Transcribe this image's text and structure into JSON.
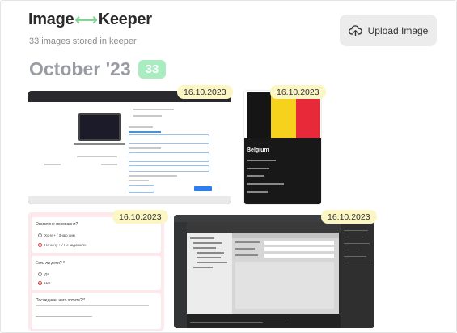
{
  "header": {
    "logo_part1": "Image",
    "logo_arrow": "⟷",
    "logo_part2": "Keeper",
    "subtitle": "33 images stored in keeper",
    "upload_label": "Upload Image",
    "upload_icon": "cloud-upload-icon"
  },
  "group": {
    "title": "October '23",
    "count": "33"
  },
  "cards": [
    {
      "date": "16.10.2023",
      "kind": "screenshot-laptop-store"
    },
    {
      "date": "16.10.2023",
      "kind": "screenshot-flag-belgium",
      "country": "Belgium"
    },
    {
      "date": "16.10.2023",
      "kind": "screenshot-form",
      "questions": [
        {
          "text": "Оживлене поховання?",
          "options": [
            "Хочу + / Знаю хим",
            "Не хочу + / Не задоволен"
          ]
        },
        {
          "text": "Есть ли дети? *",
          "options": [
            "Да",
            "Нет"
          ]
        },
        {
          "text": "Последнее, чего хотите? *",
          "options": []
        }
      ]
    },
    {
      "date": "16.10.2023",
      "kind": "screenshot-ide"
    }
  ],
  "colors": {
    "accent_green": "#a8ecc0",
    "date_tag": "#fbf6c4",
    "title_gray": "#9a9ca3"
  }
}
